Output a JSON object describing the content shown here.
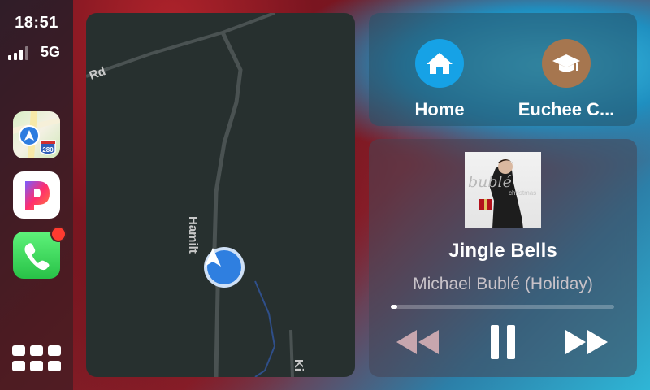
{
  "status": {
    "time": "18:51",
    "network": "5G"
  },
  "dock": {
    "apps": [
      {
        "name": "Maps",
        "icon": "maps-icon"
      },
      {
        "name": "Pandora",
        "icon": "pandora-icon",
        "color": "#e8276b"
      },
      {
        "name": "Phone",
        "icon": "phone-icon",
        "color": "#2ac24a",
        "badge": true
      }
    ],
    "highway_shield": "280",
    "app_grid_icon": "app-grid-icon"
  },
  "map": {
    "labels": {
      "road_rd": "Rd",
      "road_hamilton": "Hamilt",
      "road_ki": "Ki"
    }
  },
  "shortcuts": [
    {
      "label": "Home",
      "icon": "home-icon",
      "color": "#16a2e6"
    },
    {
      "label": "Euchee C...",
      "icon": "graduation-cap-icon",
      "color": "#a6764f"
    }
  ],
  "now_playing": {
    "song": "Jingle Bells",
    "artist": "Michael Bublé (Holiday)",
    "album_art_text": "bublé",
    "album_art_subtext": "christmas",
    "progress": 0.03,
    "controls": {
      "rewind": "rewind-icon",
      "pause": "pause-icon",
      "forward": "fast-forward-icon"
    }
  }
}
